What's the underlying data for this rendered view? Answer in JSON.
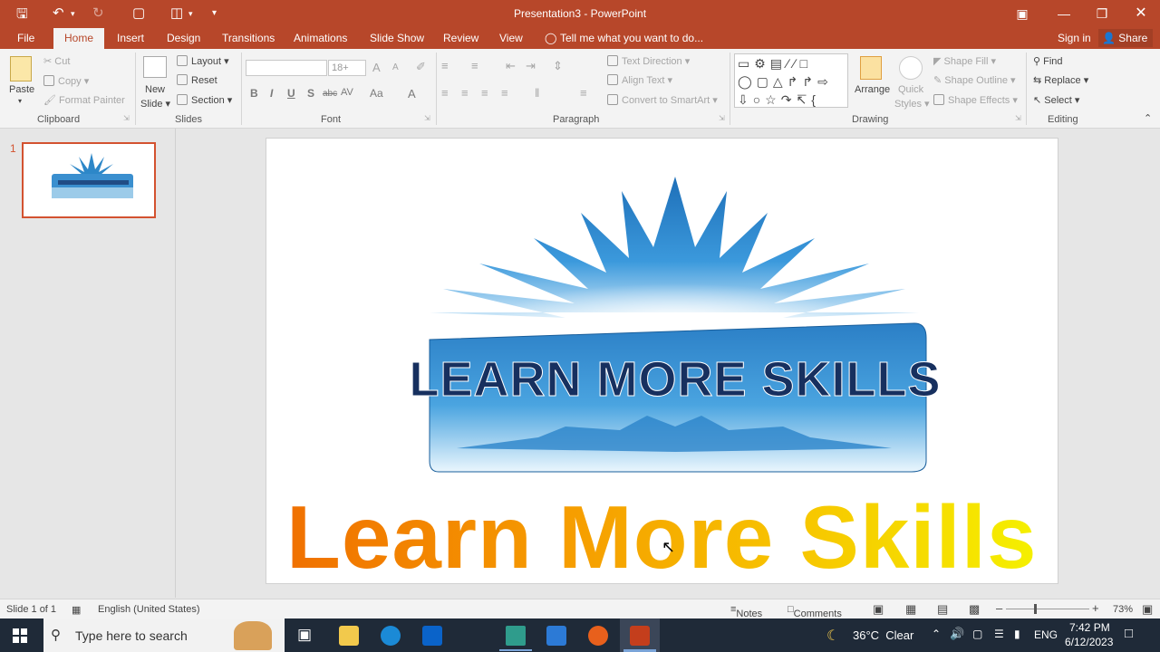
{
  "window": {
    "title": "Presentation3 - PowerPoint"
  },
  "tabs": [
    "File",
    "Home",
    "Insert",
    "Design",
    "Transitions",
    "Animations",
    "Slide Show",
    "Review",
    "View"
  ],
  "tell_me": "Tell me what you want to do...",
  "account": {
    "sign_in": "Sign in",
    "share": "Share"
  },
  "clipboard": {
    "paste": "Paste",
    "cut": "Cut",
    "copy": "Copy",
    "format_painter": "Format Painter",
    "label": "Clipboard"
  },
  "slides_group": {
    "new_slide_1": "New",
    "new_slide_2": "Slide",
    "layout": "Layout",
    "reset": "Reset",
    "section": "Section",
    "label": "Slides"
  },
  "font_group": {
    "font_size": "18+",
    "label": "Font",
    "bold": "B",
    "italic": "I",
    "underline": "U",
    "shadow": "S",
    "strike": "abc",
    "spacing": "AV",
    "case": "Aa",
    "grow": "A",
    "shrink": "A",
    "color": "A"
  },
  "paragraph_group": {
    "text_direction": "Text Direction",
    "align_text": "Align Text",
    "convert_smartart": "Convert to SmartArt",
    "label": "Paragraph"
  },
  "drawing_group": {
    "arrange": "Arrange",
    "quick_styles_1": "Quick",
    "quick_styles_2": "Styles",
    "shape_fill": "Shape Fill",
    "shape_outline": "Shape Outline",
    "shape_effects": "Shape Effects",
    "label": "Drawing"
  },
  "editing_group": {
    "find": "Find",
    "replace": "Replace",
    "select": "Select",
    "label": "Editing"
  },
  "thumbnail": {
    "number": "1"
  },
  "slide": {
    "banner_text": "LEARN MORE SKILLS",
    "big_text": "Learn More Skills"
  },
  "status": {
    "slide_info": "Slide 1 of 1",
    "language": "English (United States)",
    "notes": "Notes",
    "comments": "Comments",
    "zoom": "73%"
  },
  "taskbar": {
    "search_placeholder": "Type here to search",
    "weather": "36°C  Clear",
    "lang": "ENG",
    "time": "7:42 PM",
    "date": "6/12/2023"
  },
  "colors": {
    "accent": "#b7472a",
    "slide_border": "#d35230"
  }
}
